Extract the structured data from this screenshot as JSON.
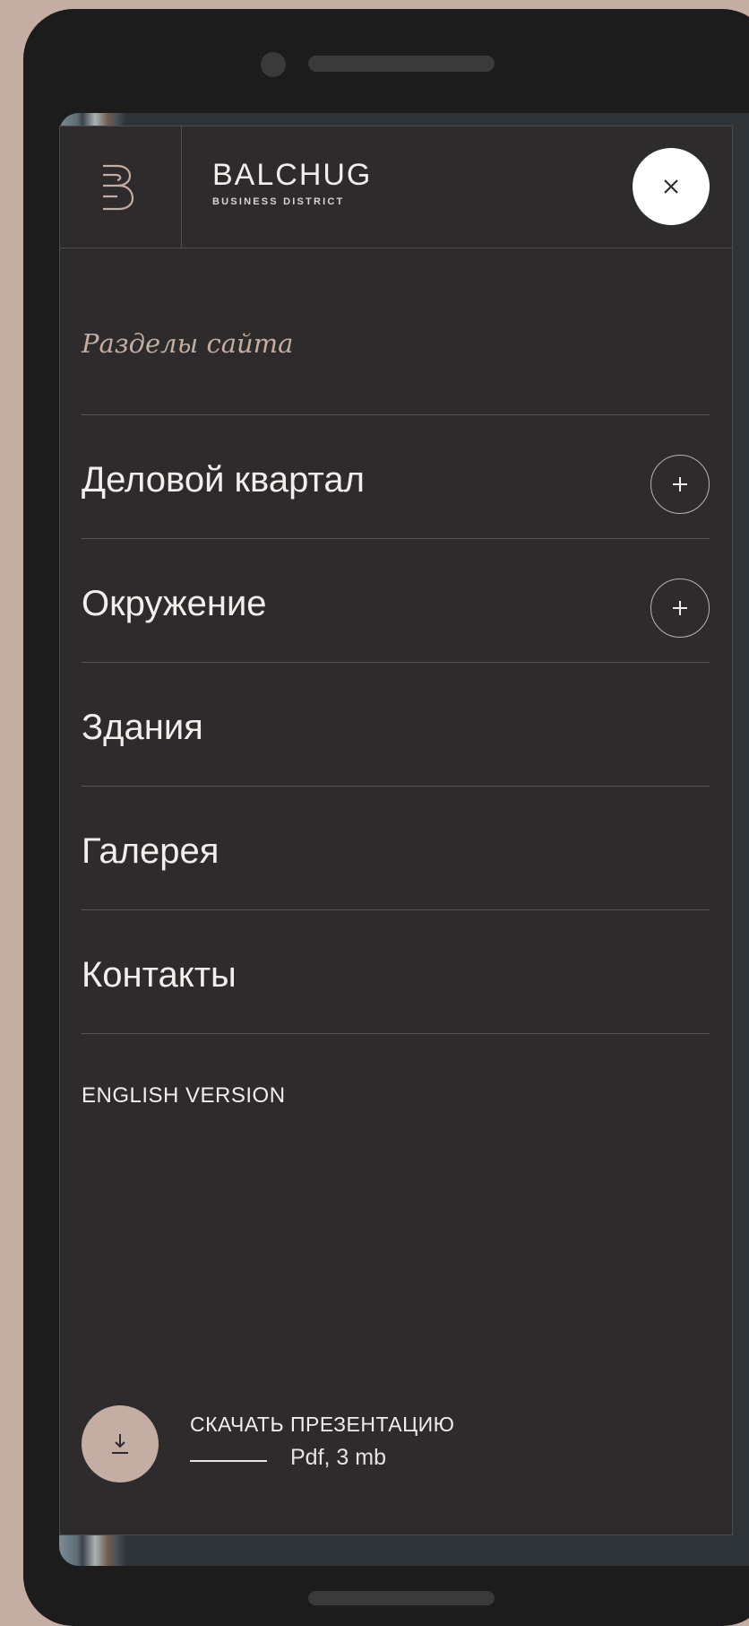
{
  "brand": {
    "name": "BALCHUG",
    "subtitle": "BUSINESS DISTRICT"
  },
  "menu": {
    "section_title": "Разделы сайта",
    "items": [
      {
        "label": "Деловой квартал",
        "expandable": true
      },
      {
        "label": "Окружение",
        "expandable": true
      },
      {
        "label": "Здания",
        "expandable": false
      },
      {
        "label": "Галерея",
        "expandable": false
      },
      {
        "label": "Контакты",
        "expandable": false
      }
    ],
    "language_link": "ENGLISH VERSION"
  },
  "download": {
    "title": "СКАЧАТЬ ПРЕЗЕНТАЦИЮ",
    "meta": "Pdf, 3 mb"
  },
  "icons": {
    "logo": "balchug-b-logo-icon",
    "close": "close-icon",
    "expand": "plus-icon",
    "download": "download-icon"
  },
  "colors": {
    "accent": "#c4ada2",
    "menu_bg": "#2d2b2c",
    "text": "#f2eeec"
  }
}
